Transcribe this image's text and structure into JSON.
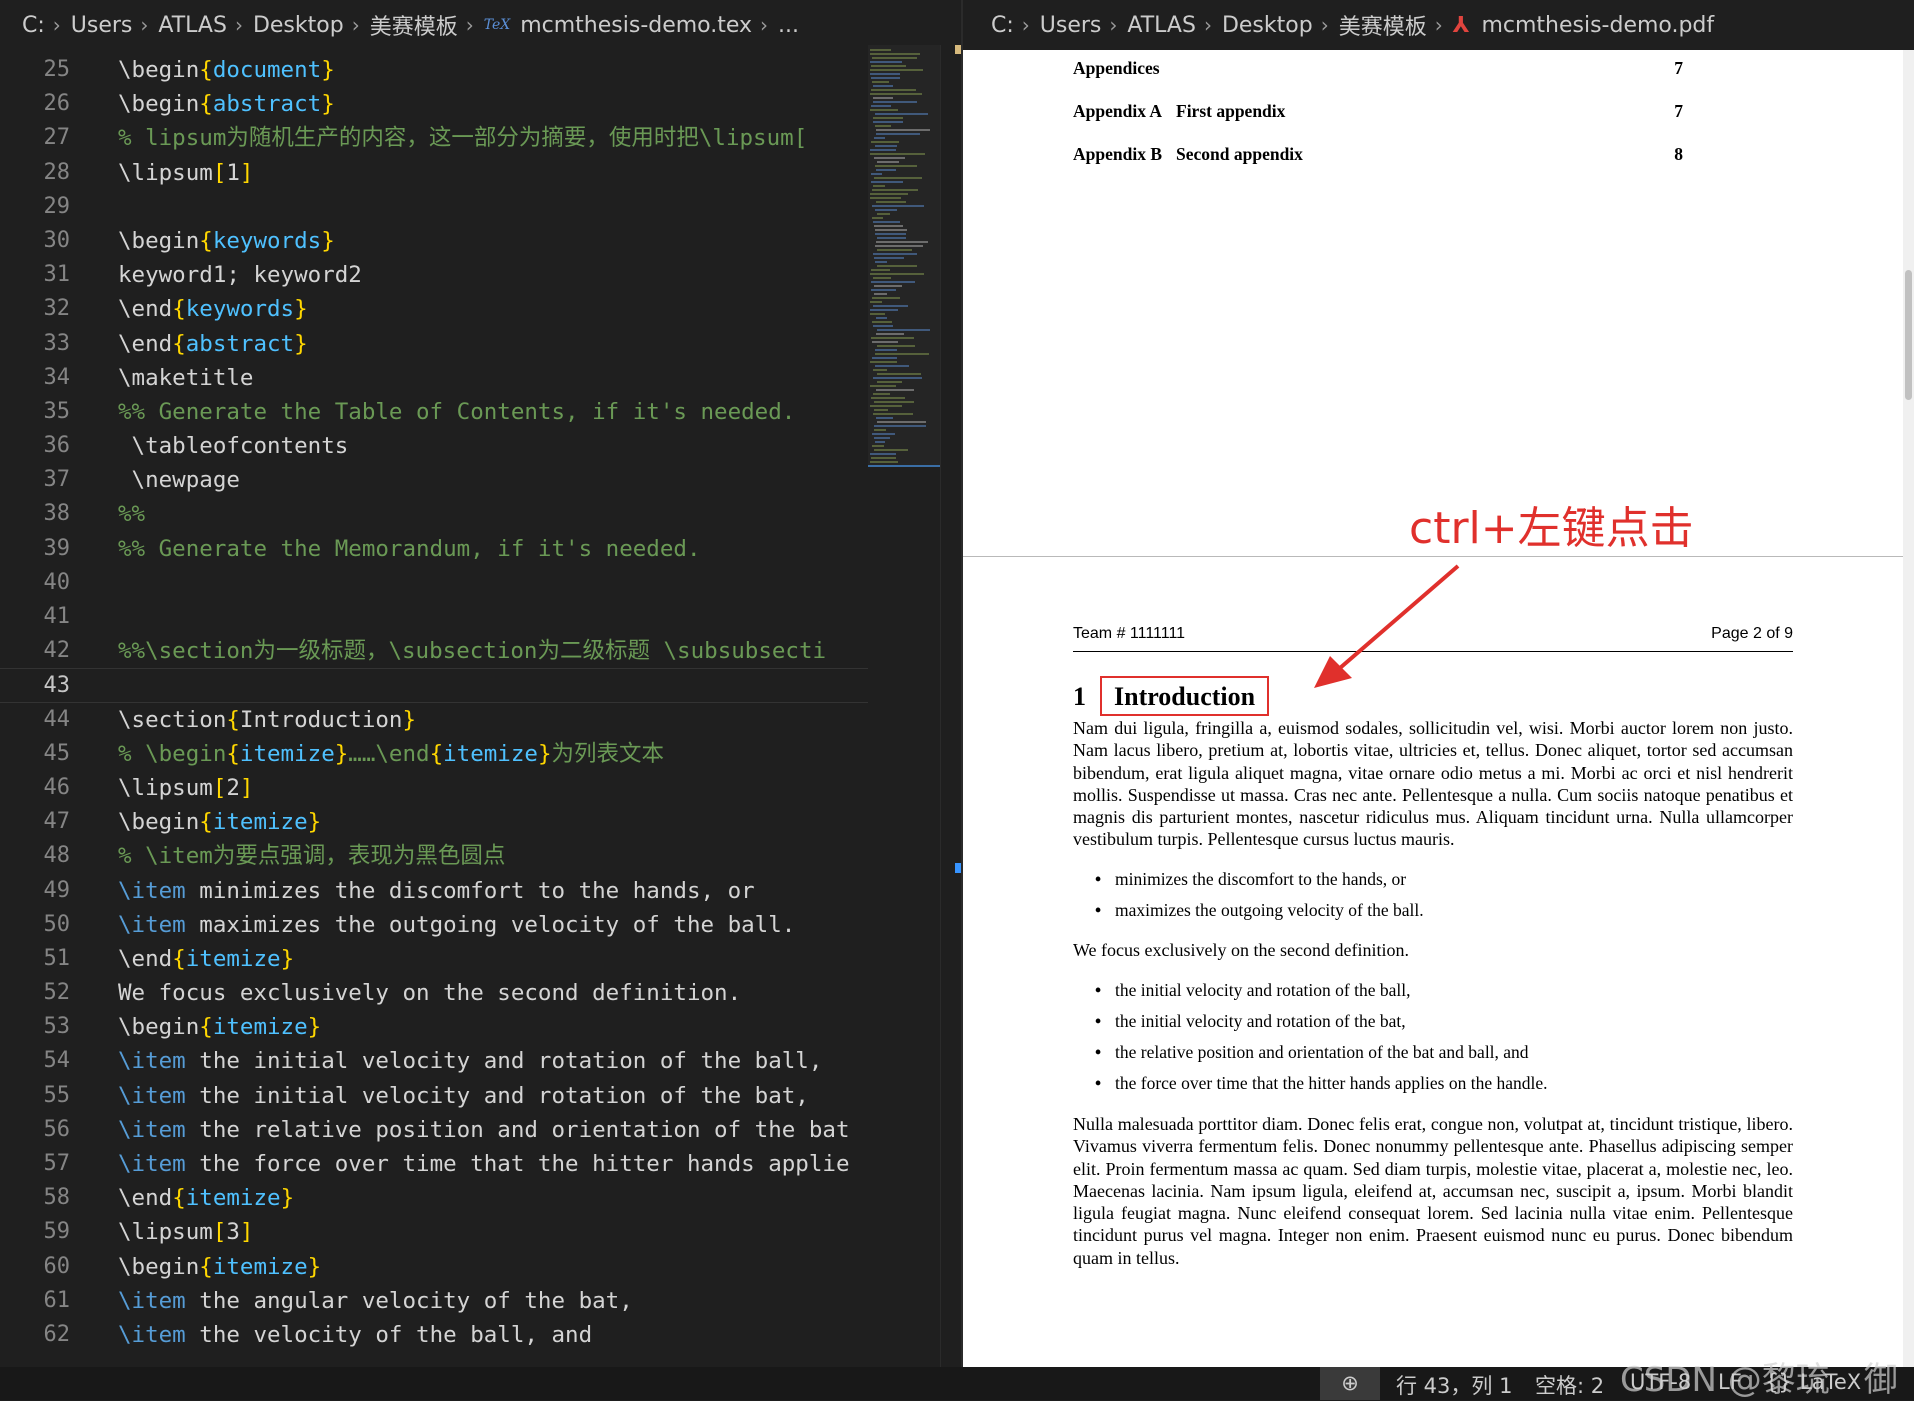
{
  "editor": {
    "breadcrumb": [
      "C:",
      "Users",
      "ATLAS",
      "Desktop",
      "美赛模板",
      "mcmthesis-demo.tex",
      "..."
    ],
    "tex_icon": "TeX",
    "current_line": 43,
    "lines": [
      {
        "n": "25",
        "html": "<span class='c-cmd'>\\begin</span><span class='c-brace'>{</span><span class='c-arg'>document</span><span class='c-brace'>}</span>"
      },
      {
        "n": "26",
        "html": "<span class='c-cmd'>\\begin</span><span class='c-brace'>{</span><span class='c-arg'>abstract</span><span class='c-brace'>}</span>"
      },
      {
        "n": "27",
        "html": "<span class='c-comment'>% lipsum为随机生产的内容，这一部分为摘要，使用时把\\lipsum[</span>"
      },
      {
        "n": "28",
        "html": "<span class='c-cmd'>\\lipsum</span><span class='c-brace'>[</span><span class='c-cmd'>1</span><span class='c-brace'>]</span>"
      },
      {
        "n": "29",
        "html": ""
      },
      {
        "n": "30",
        "html": "<span class='c-cmd'>\\begin</span><span class='c-brace'>{</span><span class='c-arg'>keywords</span><span class='c-brace'>}</span>"
      },
      {
        "n": "31",
        "html": "keyword1; keyword2"
      },
      {
        "n": "32",
        "html": "<span class='c-cmd'>\\end</span><span class='c-brace'>{</span><span class='c-arg'>keywords</span><span class='c-brace'>}</span>"
      },
      {
        "n": "33",
        "html": "<span class='c-cmd'>\\end</span><span class='c-brace'>{</span><span class='c-arg'>abstract</span><span class='c-brace'>}</span>"
      },
      {
        "n": "34",
        "html": "<span class='c-cmd'>\\maketitle</span>"
      },
      {
        "n": "35",
        "html": "<span class='c-comment'>%% Generate the Table of Contents, if it's needed.</span>"
      },
      {
        "n": "36",
        "html": " <span class='c-cmd'>\\tableofcontents</span>"
      },
      {
        "n": "37",
        "html": " <span class='c-cmd'>\\newpage</span>"
      },
      {
        "n": "38",
        "html": "<span class='c-comment'>%%</span>"
      },
      {
        "n": "39",
        "html": "<span class='c-comment'>%% Generate the Memorandum, if it's needed.</span>"
      },
      {
        "n": "40",
        "html": ""
      },
      {
        "n": "41",
        "html": ""
      },
      {
        "n": "42",
        "html": "<span class='c-comment'>%%\\section为一级标题，\\subsection为二级标题 \\subsubsecti</span>"
      },
      {
        "n": "43",
        "html": ""
      },
      {
        "n": "44",
        "html": "<span class='c-cmd'>\\section</span><span class='c-brace'>{</span><span class='c-cmd'>Introduction</span><span class='c-brace'>}</span>"
      },
      {
        "n": "45",
        "html": "<span class='c-comment'>% \\begin</span><span class='c-brace'>{</span><span class='c-arg'>itemize</span><span class='c-brace'>}</span><span class='c-comment'>……\\end</span><span class='c-brace'>{</span><span class='c-arg'>itemize</span><span class='c-brace'>}</span><span class='c-comment'>为列表文本</span>"
      },
      {
        "n": "46",
        "html": "<span class='c-cmd'>\\lipsum</span><span class='c-brace'>[</span><span class='c-cmd'>2</span><span class='c-brace'>]</span>"
      },
      {
        "n": "47",
        "html": "<span class='c-cmd'>\\begin</span><span class='c-brace'>{</span><span class='c-arg'>itemize</span><span class='c-brace'>}</span>"
      },
      {
        "n": "48",
        "html": "<span class='c-comment'>% \\item为要点强调，表现为黑色圆点</span>"
      },
      {
        "n": "49",
        "html": "<span class='c-item'>\\item</span> minimizes the discomfort to the hands, or"
      },
      {
        "n": "50",
        "html": "<span class='c-item'>\\item</span> maximizes the outgoing velocity of the ball."
      },
      {
        "n": "51",
        "html": "<span class='c-cmd'>\\end</span><span class='c-brace'>{</span><span class='c-arg'>itemize</span><span class='c-brace'>}</span>"
      },
      {
        "n": "52",
        "html": "We focus exclusively on the second definition."
      },
      {
        "n": "53",
        "html": "<span class='c-cmd'>\\begin</span><span class='c-brace'>{</span><span class='c-arg'>itemize</span><span class='c-brace'>}</span>"
      },
      {
        "n": "54",
        "html": "<span class='c-item'>\\item</span> the initial velocity and rotation of the ball,"
      },
      {
        "n": "55",
        "html": "<span class='c-item'>\\item</span> the initial velocity and rotation of the bat,"
      },
      {
        "n": "56",
        "html": "<span class='c-item'>\\item</span> the relative position and orientation of the bat"
      },
      {
        "n": "57",
        "html": "<span class='c-item'>\\item</span> the force over time that the hitter hands applie"
      },
      {
        "n": "58",
        "html": "<span class='c-cmd'>\\end</span><span class='c-brace'>{</span><span class='c-arg'>itemize</span><span class='c-brace'>}</span>"
      },
      {
        "n": "59",
        "html": "<span class='c-cmd'>\\lipsum</span><span class='c-brace'>[</span><span class='c-cmd'>3</span><span class='c-brace'>]</span>"
      },
      {
        "n": "60",
        "html": "<span class='c-cmd'>\\begin</span><span class='c-brace'>{</span><span class='c-arg'>itemize</span><span class='c-brace'>}</span>"
      },
      {
        "n": "61",
        "html": "<span class='c-item'>\\item</span> the angular velocity of the bat,"
      },
      {
        "n": "62",
        "html": "<span class='c-item'>\\item</span> the velocity of the ball, and"
      }
    ]
  },
  "pdf": {
    "breadcrumb": [
      "C:",
      "Users",
      "ATLAS",
      "Desktop",
      "美赛模板",
      "mcmthesis-demo.pdf"
    ],
    "pdf_icon": "⅄",
    "toc": [
      {
        "label": "Appendices",
        "page": "7"
      },
      {
        "label": "Appendix A",
        "title": "First appendix",
        "page": "7"
      },
      {
        "label": "Appendix B",
        "title": "Second appendix",
        "page": "8"
      }
    ],
    "header_left": "Team # 1111111",
    "header_right": "Page 2 of 9",
    "section_number": "1",
    "section_title": "Introduction",
    "para1": "Nam dui ligula, fringilla a, euismod sodales, sollicitudin vel, wisi. Morbi auctor lorem non justo. Nam lacus libero, pretium at, lobortis vitae, ultricies et, tellus. Donec aliquet, tortor sed accumsan bibendum, erat ligula aliquet magna, vitae ornare odio metus a mi. Morbi ac orci et nisl hendrerit mollis. Suspendisse ut massa. Cras nec ante. Pellentesque a nulla. Cum sociis natoque penatibus et magnis dis parturient montes, nascetur ridiculus mus. Aliquam tincidunt urna. Nulla ullamcorper vestibulum turpis. Pellentesque cursus luctus mauris.",
    "bullets1": [
      "minimizes the discomfort to the hands, or",
      "maximizes the outgoing velocity of the ball."
    ],
    "para2": "We focus exclusively on the second definition.",
    "bullets2": [
      "the initial velocity and rotation of the ball,",
      "the initial velocity and rotation of the bat,",
      "the relative position and orientation of the bat and ball, and",
      "the force over time that the hitter hands applies on the handle."
    ],
    "para3": "Nulla malesuada porttitor diam. Donec felis erat, congue non, volutpat at, tincidunt tristique, libero. Vivamus viverra fermentum felis. Donec nonummy pellentesque ante. Phasellus adipiscing semper elit. Proin fermentum massa ac quam. Sed diam turpis, molestie vitae, placerat a, molestie nec, leo. Maecenas lacinia. Nam ipsum ligula, eleifend at, accumsan nec, suscipit a, ipsum. Morbi blandit ligula feugiat magna. Nunc eleifend consequat lorem. Sed lacinia nulla vitae enim. Pellentesque tincidunt purus vel magna. Integer non enim. Praesent euismod nunc eu purus. Donec bibendum quam in tellus."
  },
  "annotation": {
    "text": "ctrl+左键点击",
    "color": "#e0302c"
  },
  "statusbar": {
    "zoom_icon": "⊕",
    "position": "行 43，列 1",
    "indent": "空格: 2",
    "encoding": "UTF-8",
    "eol": "LF",
    "language": "LaTeX",
    "language_icon": "{}"
  },
  "watermark": "CSDN @黎琉　御"
}
